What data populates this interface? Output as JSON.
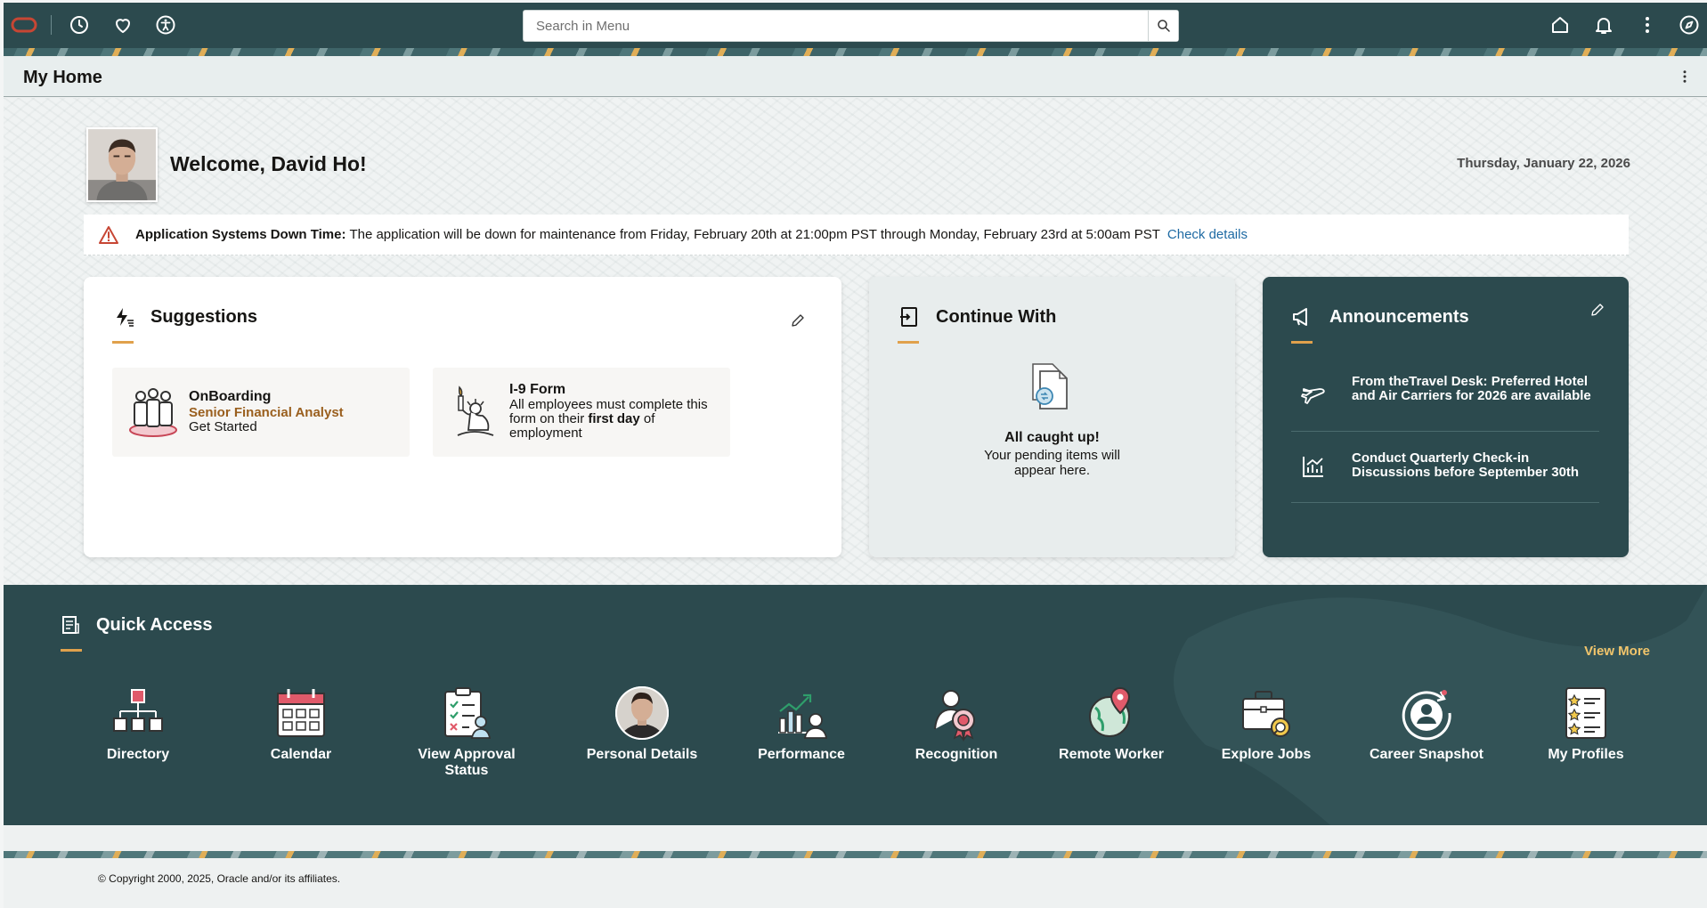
{
  "topbar": {
    "search_placeholder": "Search in Menu"
  },
  "page": {
    "title": "My Home"
  },
  "welcome": {
    "greeting": "Welcome, David Ho!",
    "date": "Thursday, January 22, 2026"
  },
  "alert": {
    "label": "Application Systems Down Time:",
    "message": "The application will be down for maintenance from Friday, February 20th at 21:00pm PST through Monday, February 23rd at 5:00am PST",
    "link": "Check details"
  },
  "suggestions": {
    "title": "Suggestions",
    "items": [
      {
        "title": "OnBoarding",
        "subtitle": "Senior Financial Analyst",
        "action": "Get Started"
      },
      {
        "title": "I-9 Form",
        "text_before": "All employees must complete this form on their",
        "text_bold": "first day",
        "text_after": "of employment"
      }
    ]
  },
  "continue_with": {
    "title": "Continue With",
    "empty_title": "All caught up!",
    "empty_text": "Your pending items will appear here."
  },
  "announcements": {
    "title": "Announcements",
    "items": [
      {
        "text": "From theTravel Desk: Preferred Hotel and Air Carriers for 2026 are available"
      },
      {
        "text": "Conduct Quarterly Check-in Discussions before September 30th"
      }
    ]
  },
  "quick_access": {
    "title": "Quick Access",
    "view_more": "View More",
    "items": [
      {
        "label": "Directory"
      },
      {
        "label": "Calendar"
      },
      {
        "label": "View Approval Status"
      },
      {
        "label": "Personal Details"
      },
      {
        "label": "Performance"
      },
      {
        "label": "Recognition"
      },
      {
        "label": "Remote Worker"
      },
      {
        "label": "Explore Jobs"
      },
      {
        "label": "Career Snapshot"
      },
      {
        "label": "My Profiles"
      }
    ]
  },
  "footer": {
    "copyright": "© Copyright 2000, 2025, Oracle and/or its affiliates."
  }
}
